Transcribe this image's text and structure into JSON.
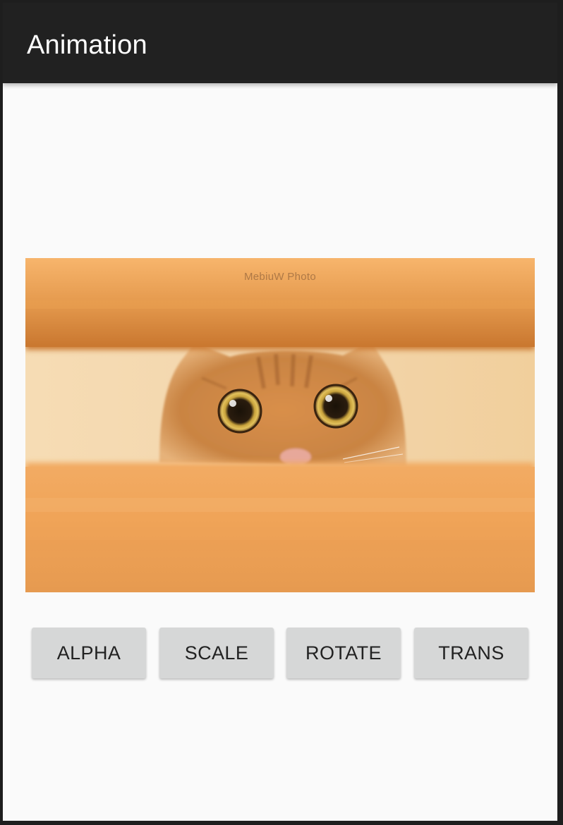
{
  "app_bar": {
    "title": "Animation"
  },
  "image": {
    "subject": "cat peeking between wooden slats",
    "watermark": "MebiuW Photo"
  },
  "buttons": [
    {
      "label": "ALPHA"
    },
    {
      "label": "SCALE"
    },
    {
      "label": "ROTATE"
    },
    {
      "label": "TRANS"
    }
  ],
  "colors": {
    "app_bar_bg": "#212121",
    "app_bar_text": "#ffffff",
    "content_bg": "#fafafa",
    "button_bg": "#d6d7d7",
    "button_text": "#222222"
  }
}
